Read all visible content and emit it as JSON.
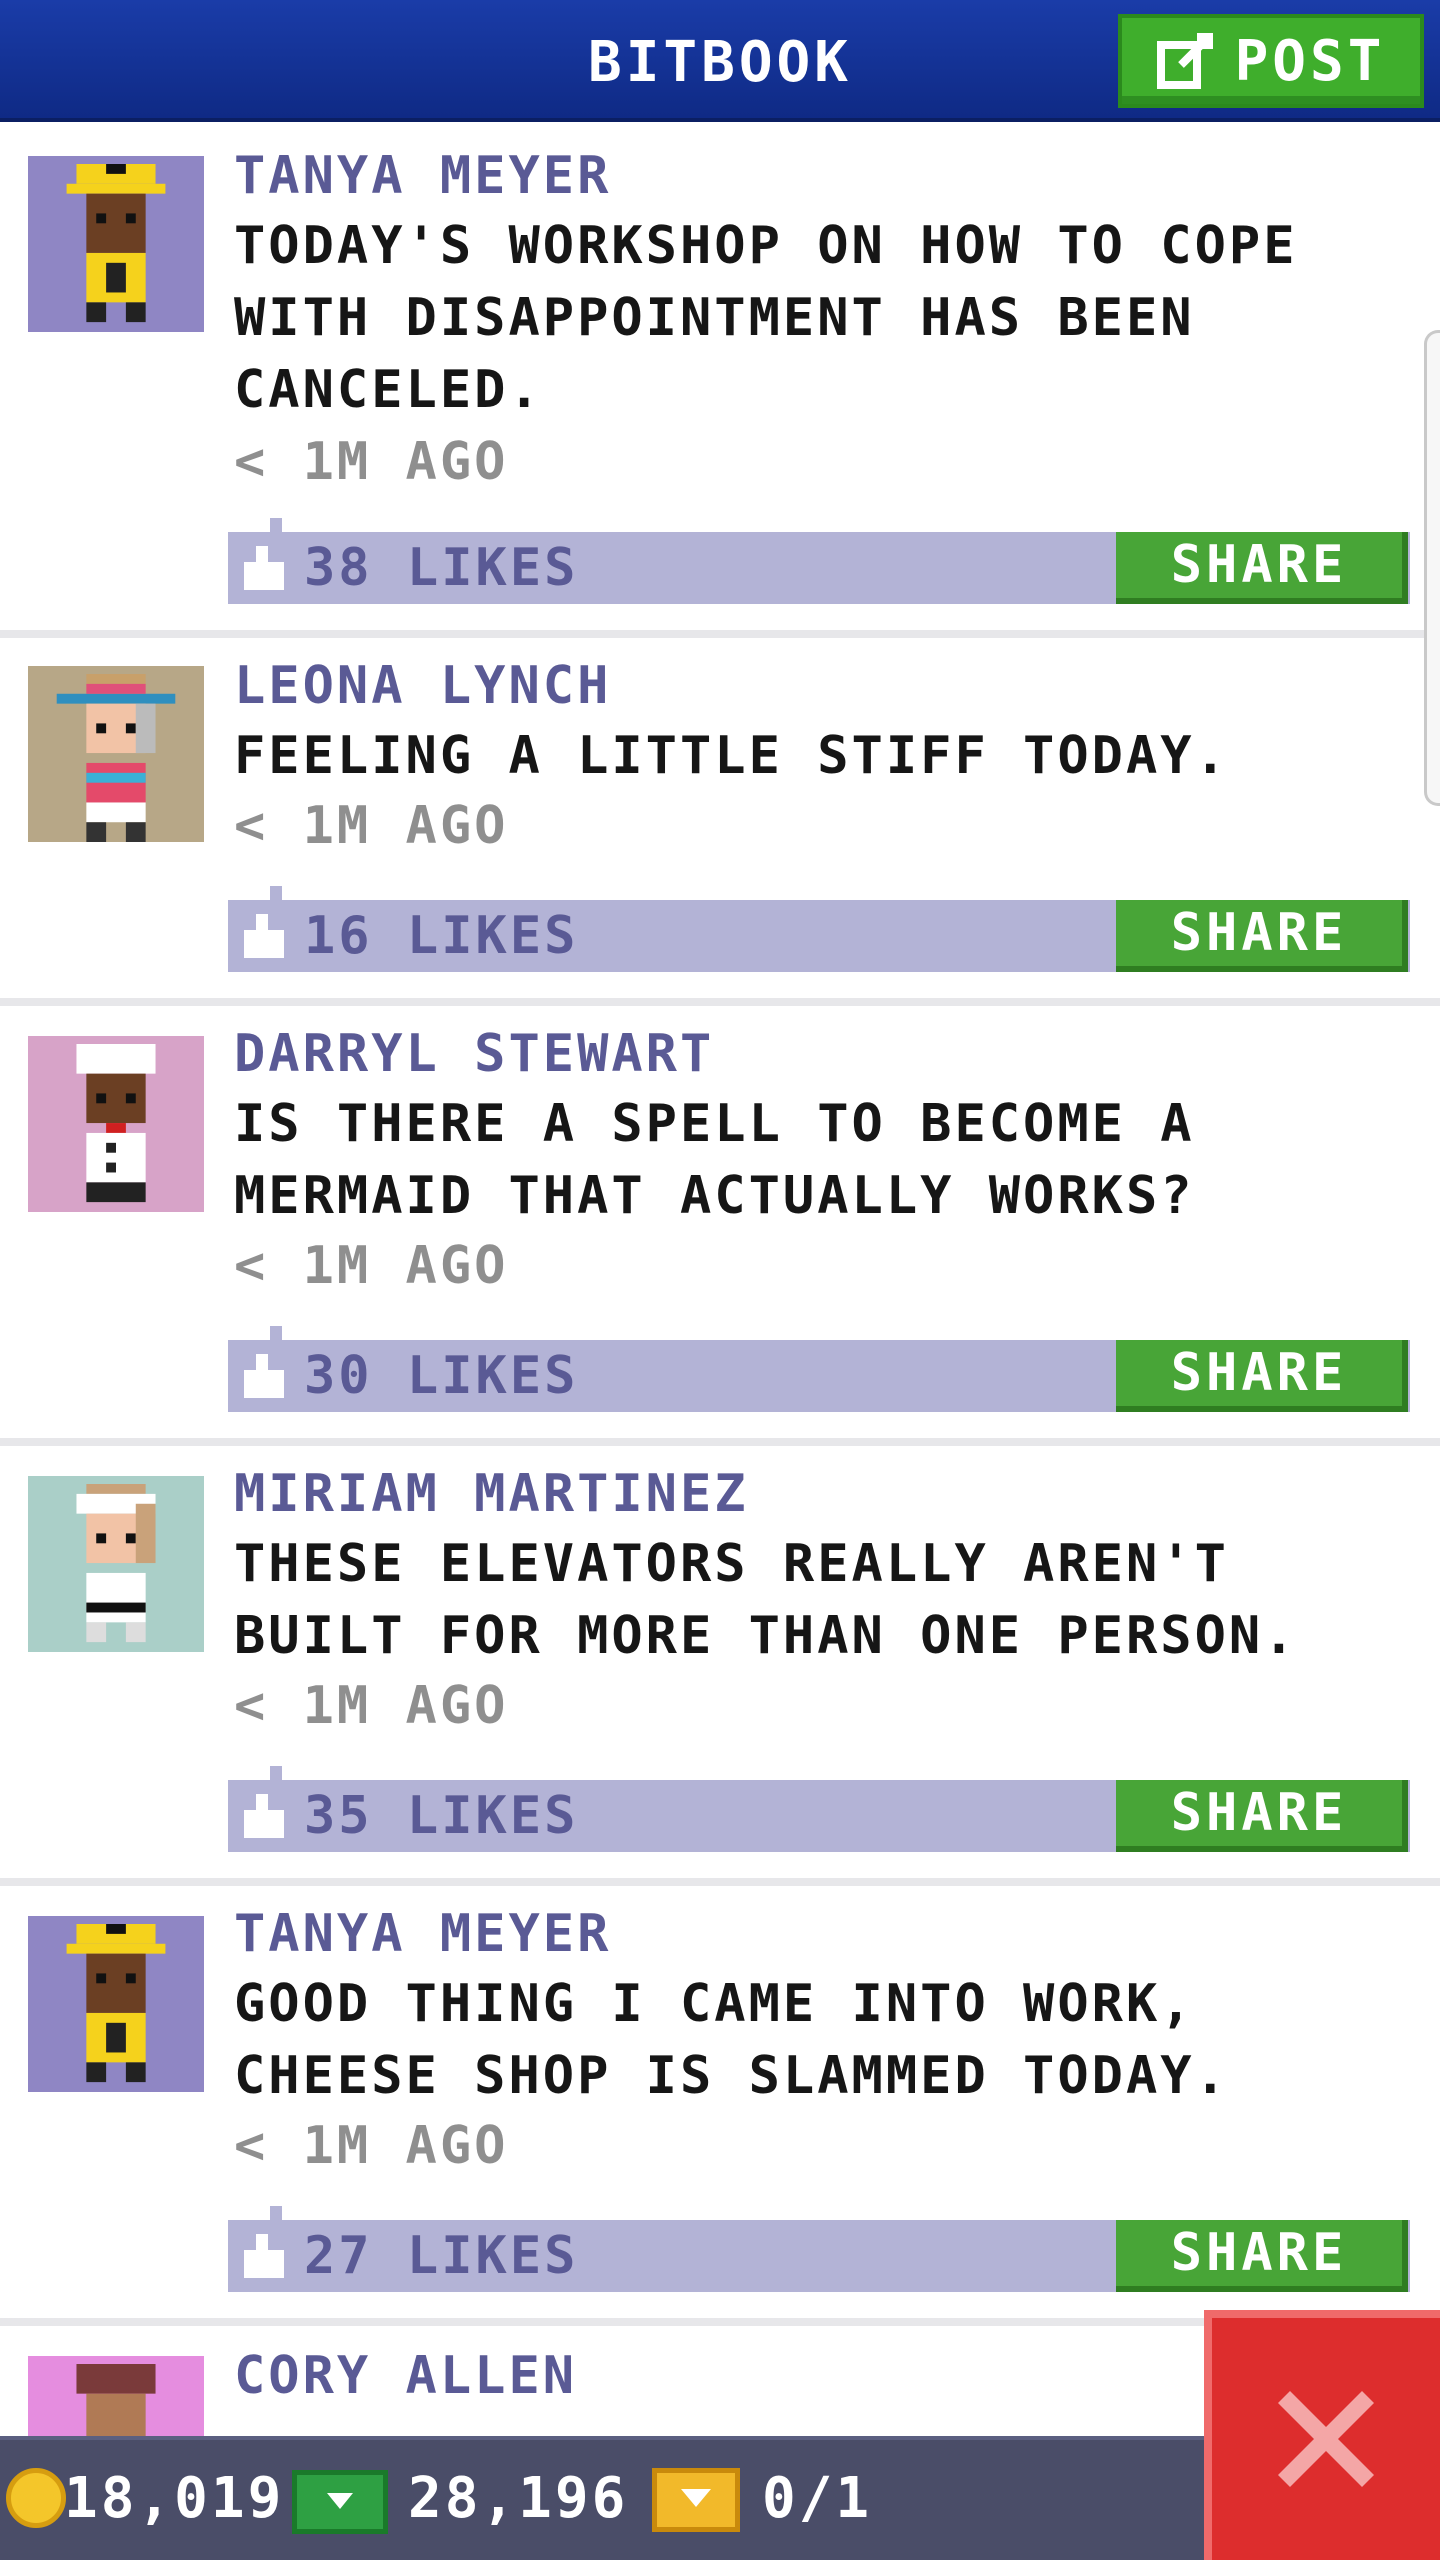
{
  "header": {
    "title": "BITBOOK",
    "post_label": "POST"
  },
  "posts": [
    {
      "author": "TANYA MEYER",
      "text": "TODAY'S WORKSHOP ON HOW TO COPE WITH DISAPPOINTMENT HAS BEEN CANCELED.",
      "time": "< 1M AGO",
      "likes": "38 LIKES",
      "share": "SHARE",
      "avatar_bg": "#8f86c4"
    },
    {
      "author": "LEONA LYNCH",
      "text": "FEELING A LITTLE STIFF TODAY.",
      "time": "< 1M AGO",
      "likes": "16 LIKES",
      "share": "SHARE",
      "avatar_bg": "#b7a787"
    },
    {
      "author": "DARRYL STEWART",
      "text": "IS THERE A SPELL TO BECOME A MERMAID THAT ACTUALLY WORKS?",
      "time": "< 1M AGO",
      "likes": "30 LIKES",
      "share": "SHARE",
      "avatar_bg": "#d7a3c8"
    },
    {
      "author": "MIRIAM MARTINEZ",
      "text": "THESE ELEVATORS REALLY AREN'T BUILT FOR MORE THAN ONE PERSON.",
      "time": "< 1M AGO",
      "likes": "35 LIKES",
      "share": "SHARE",
      "avatar_bg": "#aacfc8"
    },
    {
      "author": "TANYA MEYER",
      "text": "GOOD THING I CAME INTO WORK, CHEESE SHOP IS SLAMMED TODAY.",
      "time": "< 1M AGO",
      "likes": "27 LIKES",
      "share": "SHARE",
      "avatar_bg": "#8f86c4"
    },
    {
      "author": "CORY ALLEN",
      "avatar_bg": "#e58ddf"
    }
  ],
  "footer": {
    "coins": "18,019",
    "bux": "28,196",
    "tickets": "0/1"
  },
  "colors": {
    "header": "#1a3ca8",
    "share": "#48a537",
    "likes_bar": "#b3b3d6",
    "close": "#dd2d2d"
  }
}
